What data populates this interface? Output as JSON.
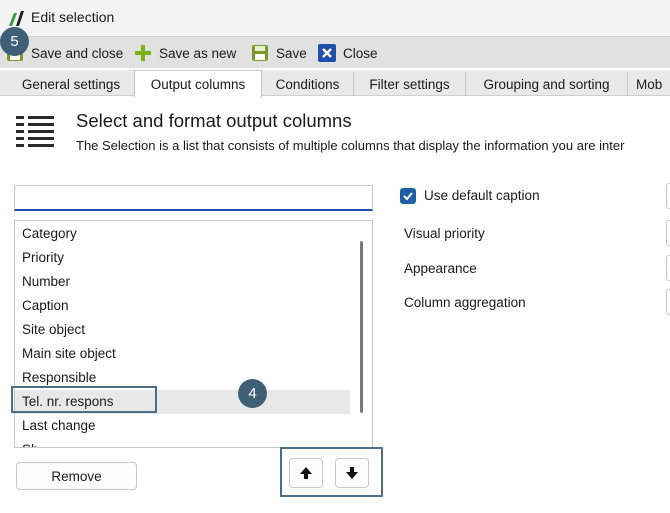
{
  "window": {
    "title": "Edit selection",
    "logo_icon": "app-logo-icon"
  },
  "toolbar": {
    "items": [
      {
        "label": "Save and close",
        "icon": "save-close-icon"
      },
      {
        "label": "Save as new",
        "icon": "plus-icon"
      },
      {
        "label": "Save",
        "icon": "save-icon"
      },
      {
        "label": "Close",
        "icon": "close-icon"
      }
    ]
  },
  "tabs": [
    {
      "label": "General settings",
      "active": false
    },
    {
      "label": "Output columns",
      "active": true
    },
    {
      "label": "Conditions",
      "active": false
    },
    {
      "label": "Filter settings",
      "active": false
    },
    {
      "label": "Grouping and sorting",
      "active": false
    },
    {
      "label": "Mob",
      "active": false
    }
  ],
  "header": {
    "icon": "columns-list-icon",
    "title": "Select and format output columns",
    "description": "The Selection is a list that consists of multiple columns that display the information you are inter"
  },
  "search": {
    "value": "",
    "placeholder": ""
  },
  "columns_list": {
    "items": [
      "Category",
      "Priority",
      "Number",
      "Caption",
      "Site object",
      "Main site object",
      "Responsible",
      "Tel. nr. respons",
      "Last change",
      "Sh"
    ],
    "selected_index": 7
  },
  "buttons": {
    "remove": "Remove",
    "move_up_icon": "arrow-up-icon",
    "move_down_icon": "arrow-down-icon"
  },
  "properties": {
    "use_default_caption": {
      "label": "Use default caption",
      "checked": true
    },
    "visual_priority": "Visual priority",
    "appearance": "Appearance",
    "column_aggregation": "Column aggregation"
  },
  "annotations": {
    "step_4": "4",
    "step_5": "5"
  },
  "colors": {
    "accent": "#1f5fa8",
    "callout": "#3f5f77",
    "callout_border": "#4c6f87",
    "toolbar_bg": "#e1e1e1",
    "selected_row": "#e8e8e8"
  }
}
